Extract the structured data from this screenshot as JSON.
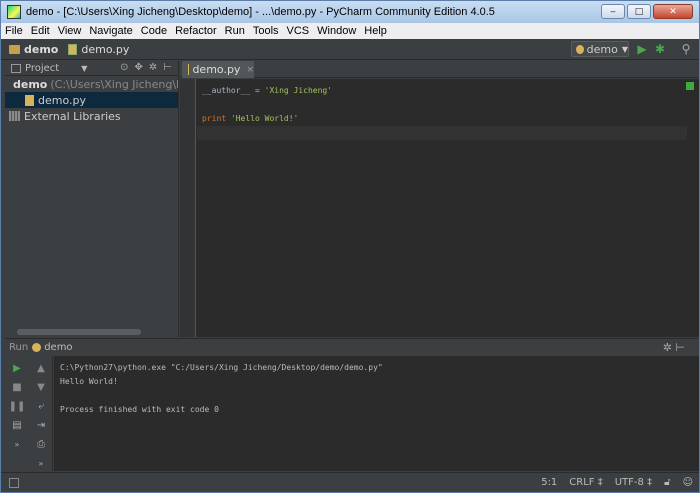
{
  "window": {
    "title": "demo - [C:\\Users\\Xing Jicheng\\Desktop\\demo] - ...\\demo.py - PyCharm Community Edition 4.0.5",
    "min_label": "‒",
    "max_label": "□",
    "close_label": "✕"
  },
  "menu": [
    "File",
    "Edit",
    "View",
    "Navigate",
    "Code",
    "Refactor",
    "Run",
    "Tools",
    "VCS",
    "Window",
    "Help"
  ],
  "navbar": {
    "project": "demo",
    "file": "demo.py",
    "run_config": "demo"
  },
  "project_panel": {
    "header": "Project",
    "root_name": "demo",
    "root_path": "(C:\\Users\\Xing Jicheng\\Desk",
    "file": "demo.py",
    "libraries": "External Libraries"
  },
  "editor": {
    "tab_label": "demo.py",
    "tab_close": "×",
    "code": {
      "line1_var": "__author__",
      "line1_eq": " = ",
      "line1_str": "'Xing Jicheng'",
      "line3_kw": "print",
      "line3_str": " 'Hello World!'"
    }
  },
  "run_panel": {
    "label": "Run",
    "config": "demo",
    "console": [
      "C:\\Python27\\python.exe \"C:/Users/Xing Jicheng/Desktop/demo/demo.py\"",
      "Hello World!",
      "",
      "Process finished with exit code 0"
    ]
  },
  "status": {
    "position": "5:1",
    "line_sep": "CRLF ‡",
    "encoding": "UTF-8 ‡"
  },
  "colors": {
    "accent_green": "#3eab3e",
    "keyword": "#cc7832",
    "string": "#a5c25c"
  }
}
